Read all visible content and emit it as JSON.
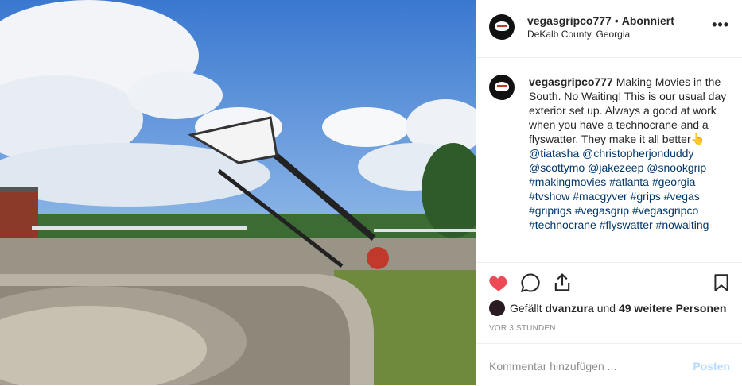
{
  "post": {
    "username": "vegasgripco777",
    "follow_status": "Abonniert",
    "location": "DeKalb County, Georgia",
    "more_label": "•••",
    "caption_text": "Making Movies in the South. No Waiting! This is our usual day exterior set up. Always a good at work when you have a technocrane and a flyswatter. They make it all better👆",
    "caption_tags": "@tiatasha @christopherjonduddy @scottymo @jakezeep @snookgrip #makingmovies #atlanta #georgia #tvshow #macgyver #grips #vegas #griprigs #vegasgrip #vegasgripco #technocrane #flyswatter #nowaiting",
    "likes_prefix": "Gefällt",
    "likes_user": "dvanzura",
    "likes_mid": "und",
    "likes_count": "49 weitere Personen",
    "timestamp": "VOR 3 STUNDEN",
    "comment_placeholder": "Kommentar hinzufügen ...",
    "post_button": "Posten"
  },
  "colors": {
    "like_red": "#ed4956",
    "link_blue": "#00376b",
    "post_disabled": "#b3dbff",
    "sky": "#4a86d6"
  },
  "icons": [
    "heart-icon",
    "comment-icon",
    "share-icon",
    "bookmark-icon",
    "more-icon"
  ]
}
